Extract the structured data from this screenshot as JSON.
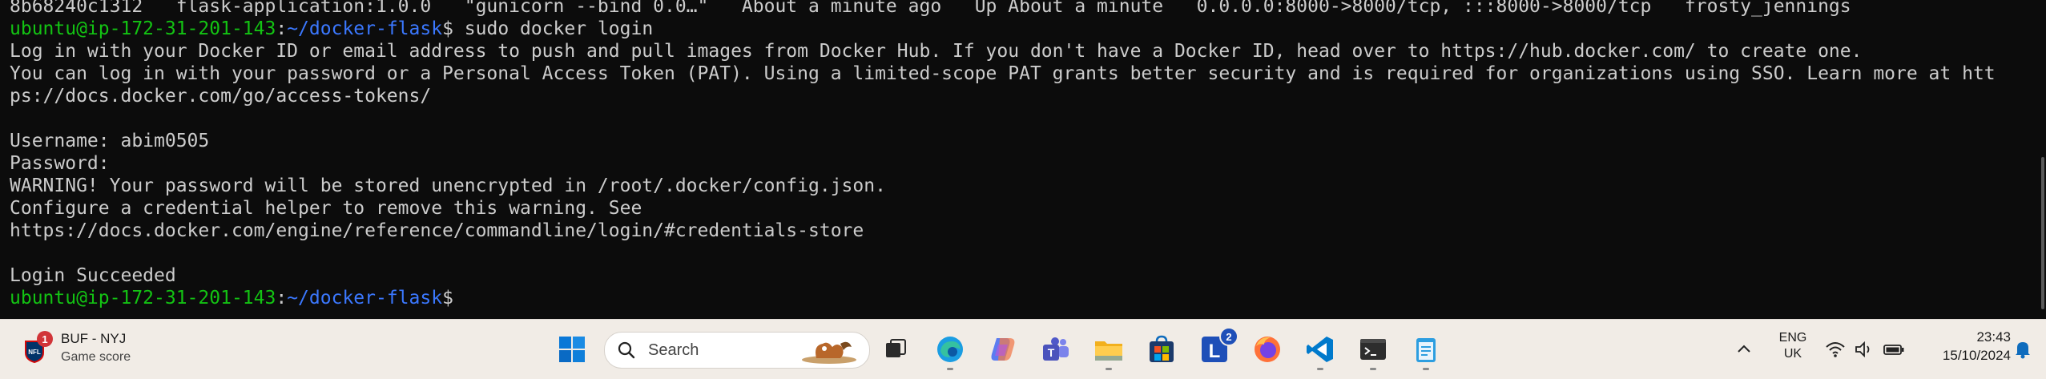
{
  "terminal": {
    "lines": [
      {
        "text": "8b68240c1312   flask-application:1.0.0   \"gunicorn --bind 0.0…\"   About a minute ago   Up About a minute   0.0.0.0:8000->8000/tcp, :::8000->8000/tcp   frosty_jennings"
      },
      {
        "user": "ubuntu@ip-172-31-201-143",
        "sep": ":",
        "path": "~/docker-flask",
        "cmd": "$ sudo docker login"
      },
      {
        "text": "Log in with your Docker ID or email address to push and pull images from Docker Hub. If you don't have a Docker ID, head over to https://hub.docker.com/ to create one."
      },
      {
        "text": "You can log in with your password or a Personal Access Token (PAT). Using a limited-scope PAT grants better security and is required for organizations using SSO. Learn more at htt"
      },
      {
        "text": "ps://docs.docker.com/go/access-tokens/"
      },
      {
        "text": ""
      },
      {
        "text": "Username: abim0505"
      },
      {
        "text": "Password:"
      },
      {
        "text": "WARNING! Your password will be stored unencrypted in /root/.docker/config.json."
      },
      {
        "text": "Configure a credential helper to remove this warning. See"
      },
      {
        "text": "https://docs.docker.com/engine/reference/commandline/login/#credentials-store"
      },
      {
        "text": ""
      },
      {
        "text": "Login Succeeded"
      },
      {
        "user": "ubuntu@ip-172-31-201-143",
        "sep": ":",
        "path": "~/docker-flask",
        "cmd": "$"
      }
    ]
  },
  "taskbar": {
    "widget": {
      "badge": "1",
      "title": "BUF - NYJ",
      "subtitle": "Game score"
    },
    "search": {
      "placeholder": "Search"
    },
    "apps": [
      {
        "name": "start-button",
        "icon": "windows-logo-icon"
      },
      {
        "name": "task-view",
        "icon": "task-view-icon"
      },
      {
        "name": "edge",
        "icon": "edge-icon"
      },
      {
        "name": "copilot",
        "icon": "copilot-icon"
      },
      {
        "name": "teams",
        "icon": "teams-icon"
      },
      {
        "name": "file-explorer",
        "icon": "folder-icon"
      },
      {
        "name": "microsoft-store",
        "icon": "store-icon"
      },
      {
        "name": "l-app",
        "icon": "l-app-icon",
        "badge": "2"
      },
      {
        "name": "firefox",
        "icon": "firefox-icon"
      },
      {
        "name": "vscode",
        "icon": "vscode-icon"
      },
      {
        "name": "terminal",
        "icon": "terminal-icon"
      },
      {
        "name": "notepad",
        "icon": "notepad-icon"
      }
    ],
    "tray": {
      "lang_top": "ENG",
      "lang_bottom": "UK",
      "time": "23:43",
      "date": "15/10/2024"
    },
    "colors": {
      "accent": "#0078d4",
      "terminal_green": "#13c313",
      "terminal_blue": "#3b78ff"
    }
  }
}
